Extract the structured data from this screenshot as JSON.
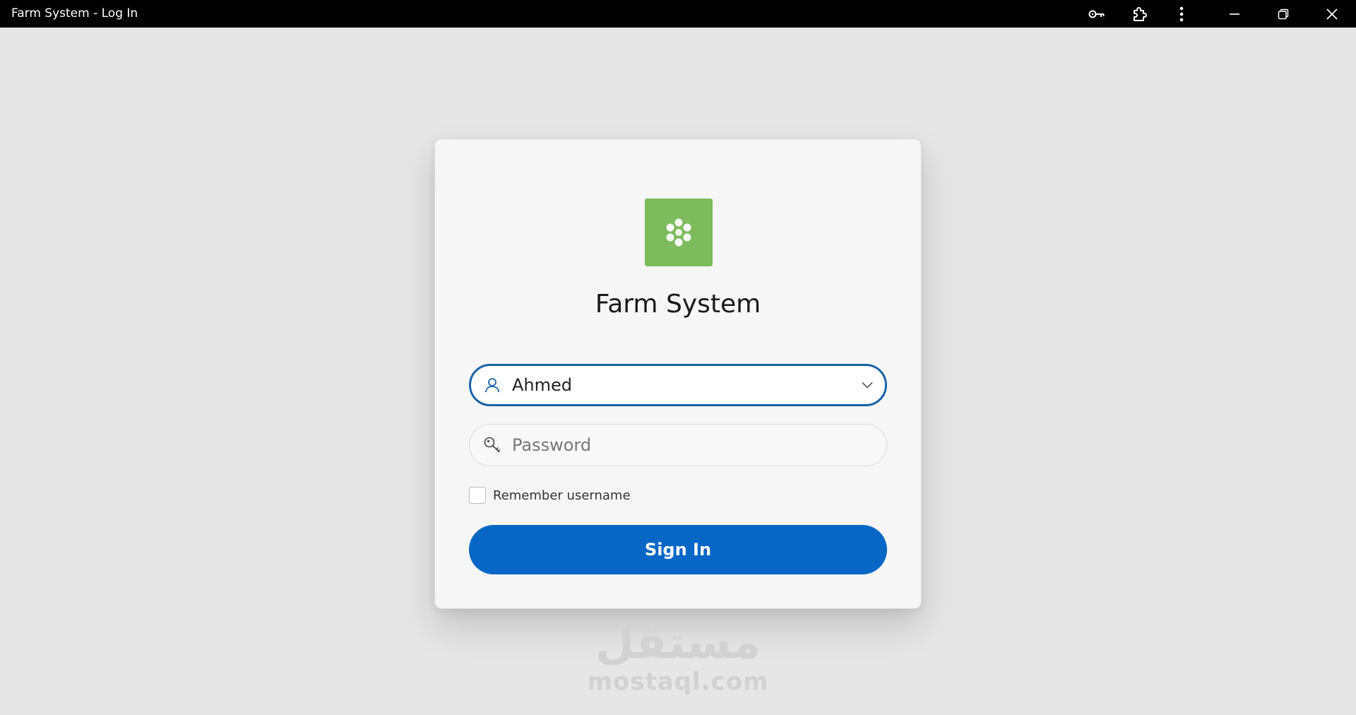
{
  "window": {
    "title": "Farm System - Log In",
    "controls": [
      "key-icon",
      "extension-icon",
      "more-vertical-icon",
      "minimize-icon",
      "restore-icon",
      "close-icon"
    ]
  },
  "login": {
    "app_name": "Farm System",
    "logo_icon": "flower-dots-icon",
    "logo_color": "#7dbb5d",
    "username": {
      "value": "Ahmed",
      "icon": "user-icon"
    },
    "password": {
      "placeholder": "Password",
      "icon": "key-icon"
    },
    "remember": {
      "label": "Remember username",
      "checked": false
    },
    "signin_label": "Sign In",
    "accent_color": "#0867c6"
  },
  "watermark": {
    "arabic": "مستقل",
    "latin": "mostaql.com"
  }
}
